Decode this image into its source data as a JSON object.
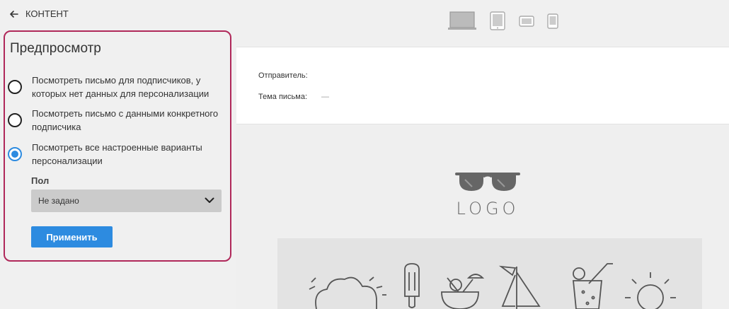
{
  "nav": {
    "back_label": "КОНТЕНТ"
  },
  "panel": {
    "title": "Предпросмотр",
    "options": [
      {
        "label": "Посмотреть письмо для подписчиков, у которых нет данных для персонализации",
        "selected": false
      },
      {
        "label": "Посмотреть письмо с данными конкретного подписчика",
        "selected": false
      },
      {
        "label": "Посмотреть все настроенные варианты персонализации",
        "selected": true
      }
    ],
    "field_label": "Пол",
    "select_value": "Не задано",
    "apply_label": "Применить"
  },
  "devices": [
    "desktop-icon",
    "tablet-icon",
    "tablet-landscape-icon",
    "mobile-icon"
  ],
  "header": {
    "sender_label": "Отправитель:",
    "sender_value": "",
    "subject_label": "Тема письма:",
    "subject_value": "—"
  },
  "preview": {
    "logo_text": "LOGO"
  },
  "colors": {
    "accent": "#2d8be0",
    "panel_border": "#b0285a"
  }
}
